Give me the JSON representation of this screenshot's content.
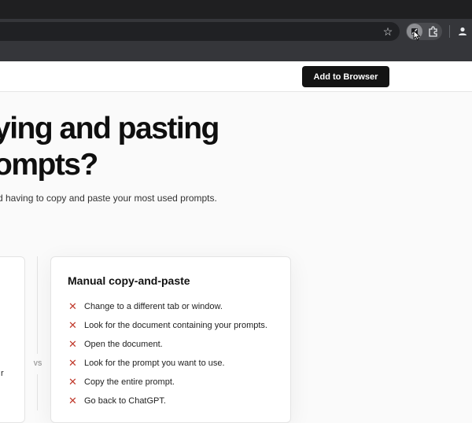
{
  "browser": {
    "star_icon": "star-icon",
    "extension_icon": "prompt-extension-icon",
    "puzzle_icon": "extensions-puzzle-icon",
    "profile_icon": "profile-icon"
  },
  "header": {
    "cta_label": "Add to Browser"
  },
  "hero": {
    "title_line1": "ying and pasting",
    "title_line2": "ompts?",
    "subtitle": "d having to copy and paste your most used prompts."
  },
  "compare": {
    "left_fragment": "r",
    "vs_label": "VS",
    "card_title": "Manual copy-and-paste",
    "steps": [
      "Change to a different tab or window.",
      "Look for the document containing your prompts.",
      "Open the document.",
      "Look for the prompt you want to use.",
      "Copy the entire prompt.",
      "Go back to ChatGPT."
    ]
  },
  "colors": {
    "cta_bg": "#141414",
    "cross": "#c0392b",
    "browser_chrome": "#35363a"
  }
}
